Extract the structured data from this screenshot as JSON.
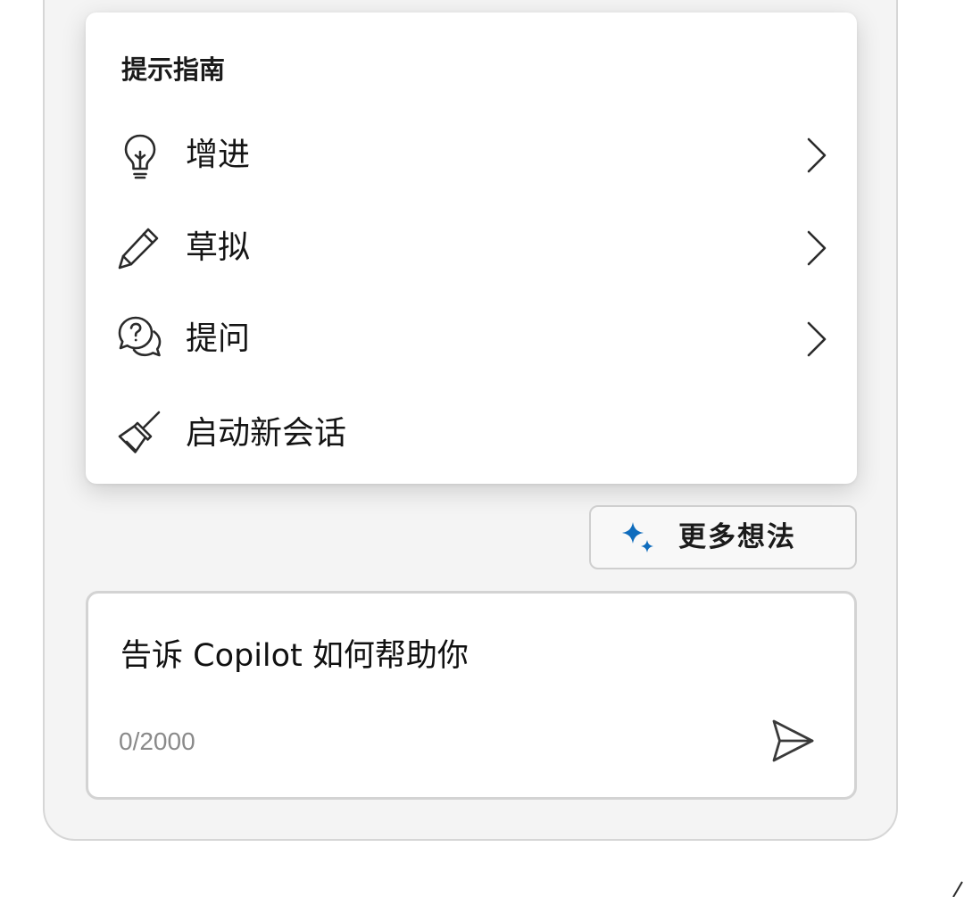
{
  "prompt_guide": {
    "title": "提示指南",
    "items": [
      {
        "label": "增进",
        "icon": "lightbulb-icon",
        "has_submenu": true
      },
      {
        "label": "草拟",
        "icon": "pencil-icon",
        "has_submenu": true
      },
      {
        "label": "提问",
        "icon": "question-chat-icon",
        "has_submenu": true
      },
      {
        "label": "启动新会话",
        "icon": "broom-icon",
        "has_submenu": false
      }
    ]
  },
  "more_ideas": {
    "label": "更多想法",
    "icon": "sparkle-icon",
    "icon_color": "#0f6cbd"
  },
  "composer": {
    "placeholder": "告诉 Copilot 如何帮助你",
    "value": "",
    "char_count": "0/2000",
    "send_icon": "send-icon"
  },
  "colors": {
    "panel_background": "#f4f4f4",
    "border": "#d3d3d3",
    "accent": "#0f6cbd"
  }
}
